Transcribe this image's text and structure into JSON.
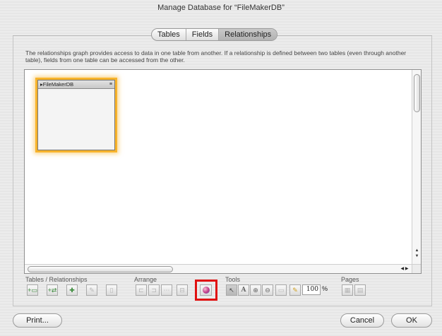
{
  "window": {
    "title": "Manage Database for “FileMakerDB”"
  },
  "tabs": [
    {
      "label": "Tables",
      "active": false
    },
    {
      "label": "Fields",
      "active": false
    },
    {
      "label": "Relationships",
      "active": true
    }
  ],
  "description": "The relationships graph provides access to data in one table from another. If a relationship is defined between two tables (even through another table), fields from one table can be accessed from the other.",
  "graph": {
    "tables": [
      {
        "name": "FileMakerDB",
        "selected": true
      }
    ]
  },
  "toolbar": {
    "tables_relationships_label": "Tables / Relationships",
    "arrange_label": "Arrange",
    "tools_label": "Tools",
    "pages_label": "Pages",
    "zoom_value": "100",
    "zoom_unit": "%"
  },
  "footer": {
    "print_label": "Print...",
    "cancel_label": "Cancel",
    "ok_label": "OK"
  },
  "colors": {
    "selection_glow": "#f7b32b",
    "highlight_box": "#e01010"
  }
}
